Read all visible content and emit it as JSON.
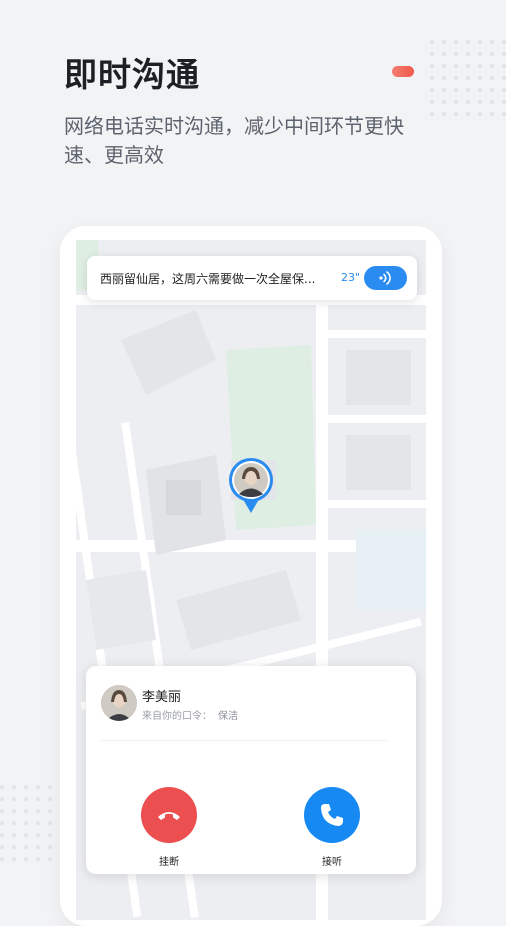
{
  "header": {
    "title": "即时沟通",
    "subtitle": "网络电话实时沟通，减少中间环节更快速、更高效"
  },
  "message_bar": {
    "text": "西丽留仙居，这周六需要做一次全屋保...",
    "duration": "23\"",
    "icon": "voice-wave-icon"
  },
  "incoming_call": {
    "caller_name": "李美丽",
    "source_label": "来自你的口令：",
    "source_tag": "保洁",
    "hangup_label": "挂断",
    "answer_label": "接听"
  },
  "colors": {
    "accent_red": "#ec4f4f",
    "accent_blue": "#168af2",
    "voice_blue": "#2a8cf0"
  }
}
